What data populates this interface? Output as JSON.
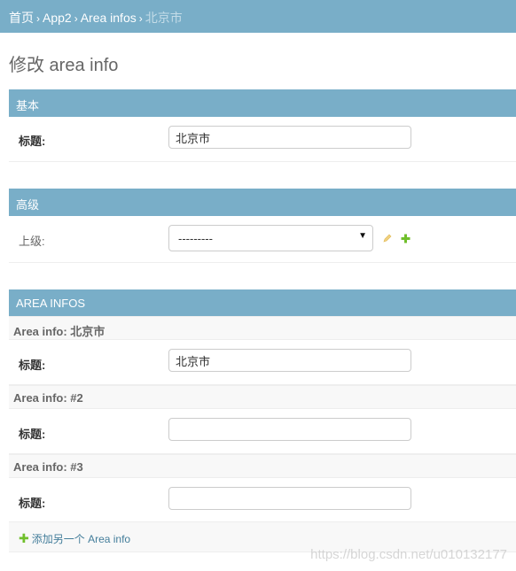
{
  "breadcrumbs": {
    "home": "首页",
    "app": "App2",
    "model": "Area infos",
    "current": "北京市",
    "separator": "›"
  },
  "page_title": "修改 area info",
  "sections": {
    "basic": {
      "title": "基本",
      "field_label": "标题:",
      "field_value": "北京市"
    },
    "advanced": {
      "title": "高级",
      "field_label": "上级:",
      "select_value": "---------",
      "edit_icon": "pencil-icon",
      "add_icon": "plus-icon"
    }
  },
  "inline": {
    "title": "AREA INFOS",
    "items": [
      {
        "header": "Area info: 北京市",
        "field_label": "标题:",
        "value": "北京市"
      },
      {
        "header": "Area info: #2",
        "field_label": "标题:",
        "value": ""
      },
      {
        "header": "Area info: #3",
        "field_label": "标题:",
        "value": ""
      }
    ],
    "add_label": "添加另一个 Area info"
  },
  "watermark": "https://blog.csdn.net/u010132177",
  "colors": {
    "header_bg": "#79aec8",
    "link": "#447e9b",
    "add_green": "#70bf2b",
    "edit_icon": "#f0d080"
  }
}
